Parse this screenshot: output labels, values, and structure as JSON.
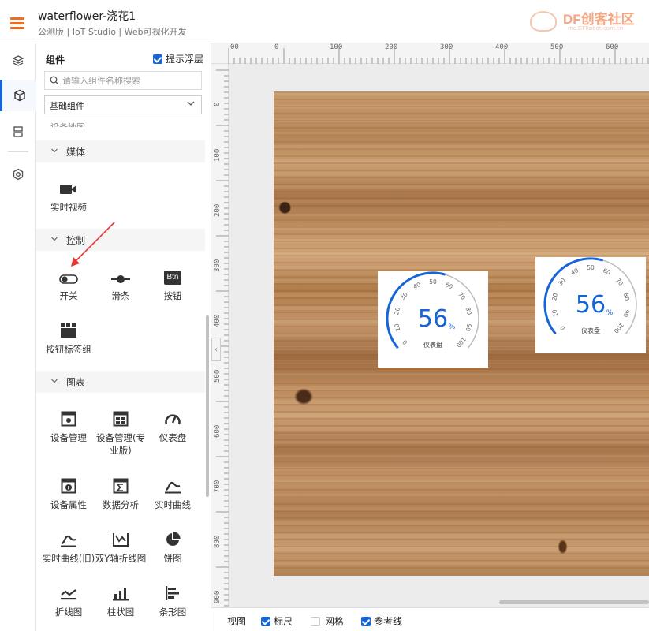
{
  "header": {
    "title": "waterflower-浇花1",
    "subtitle": "公测版 | IoT Studio | Web可视化开发",
    "brand_logo": "DF创客社区",
    "brand_sub": "mc.DFRobot.com.cn",
    "accent_color": "#f26b1d"
  },
  "rail": {
    "items": [
      {
        "icon": "layers-icon",
        "active": false
      },
      {
        "icon": "cube-icon",
        "active": true
      },
      {
        "icon": "storage-icon",
        "active": false
      },
      {
        "icon": "settings-hex-icon",
        "active": false
      }
    ]
  },
  "panel": {
    "title": "组件",
    "float_tip_label": "提示浮层",
    "float_tip_checked": true,
    "search_placeholder": "请输入组件名称搜索",
    "category_selected": "基础组件",
    "cut_label": "设备地图",
    "groups": {
      "media": {
        "label": "媒体",
        "items": [
          {
            "label": "实时视频",
            "icon": "video-camera-icon"
          }
        ]
      },
      "control": {
        "label": "控制",
        "items": [
          {
            "label": "开关",
            "icon": "toggle-switch-icon"
          },
          {
            "label": "滑条",
            "icon": "slider-icon"
          },
          {
            "label": "按钮",
            "icon": "button-icon",
            "icon_text": "Btn"
          },
          {
            "label": "按钮标签组",
            "icon": "button-tab-group-icon"
          }
        ]
      },
      "charts": {
        "label": "图表",
        "items": [
          {
            "label": "设备管理",
            "icon": "device-manage-icon"
          },
          {
            "label": "设备管理(专业版)",
            "icon": "device-manage-pro-icon"
          },
          {
            "label": "仪表盘",
            "icon": "gauge-icon"
          },
          {
            "label": "设备属性",
            "icon": "device-property-icon"
          },
          {
            "label": "数据分析",
            "icon": "data-analysis-icon"
          },
          {
            "label": "实时曲线",
            "icon": "realtime-curve-icon"
          },
          {
            "label": "实时曲线(旧)",
            "icon": "realtime-curve-old-icon"
          },
          {
            "label": "双Y轴折线图",
            "icon": "dual-axis-line-icon"
          },
          {
            "label": "饼图",
            "icon": "pie-chart-icon"
          },
          {
            "label": "折线图",
            "icon": "line-chart-icon"
          },
          {
            "label": "柱状图",
            "icon": "bar-chart-icon"
          },
          {
            "label": "条形图",
            "icon": "horizontal-bar-icon"
          }
        ]
      }
    }
  },
  "ruler": {
    "top_labels": [
      "00",
      "0",
      "100",
      "200",
      "300",
      "400",
      "500",
      "600"
    ],
    "left_labels": [
      "0",
      "100",
      "200",
      "300",
      "400",
      "500",
      "600",
      "700",
      "800",
      "900"
    ]
  },
  "gauges": [
    {
      "value": "56",
      "unit": "%",
      "label": "仪表盘",
      "ticks": [
        "0",
        "10",
        "20",
        "30",
        "40",
        "50",
        "60",
        "70",
        "80",
        "90",
        "100"
      ],
      "fraction": 0.56
    },
    {
      "value": "56",
      "unit": "%",
      "label": "仪表盘",
      "ticks": [
        "0",
        "10",
        "20",
        "30",
        "40",
        "50",
        "60",
        "70",
        "80",
        "90",
        "100"
      ],
      "fraction": 0.56
    }
  ],
  "gauge_color": "#1565d8",
  "bottombar": {
    "view_label": "视图",
    "ruler_label": "标尺",
    "ruler_checked": true,
    "grid_label": "网格",
    "grid_checked": false,
    "guides_label": "参考线",
    "guides_checked": true
  }
}
